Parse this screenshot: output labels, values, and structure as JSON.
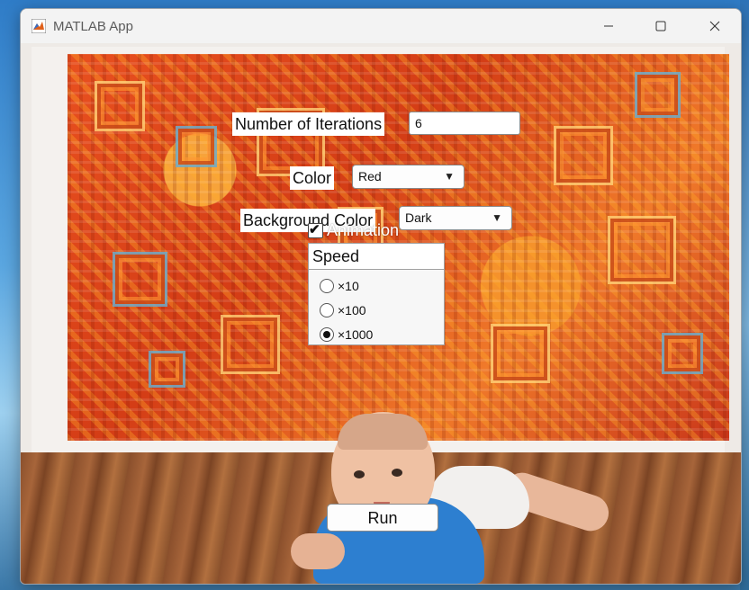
{
  "window": {
    "title": "MATLAB App"
  },
  "form": {
    "iterations_label": "Number of Iterations",
    "iterations_value": "6",
    "color_label": "Color",
    "color_selected": "Red",
    "background_label": "Background Color",
    "background_selected": "Dark",
    "animation_label": "Animation",
    "animation_checked": true
  },
  "speed": {
    "title": "Speed",
    "options": [
      "×10",
      "×100",
      "×1000"
    ],
    "selected": "×1000"
  },
  "run_label": "Run",
  "icons": [
    "matlab-logo-icon",
    "minimize-icon",
    "maximize-icon",
    "close-icon",
    "dropdown-arrow-icon",
    "checkmark-icon"
  ]
}
